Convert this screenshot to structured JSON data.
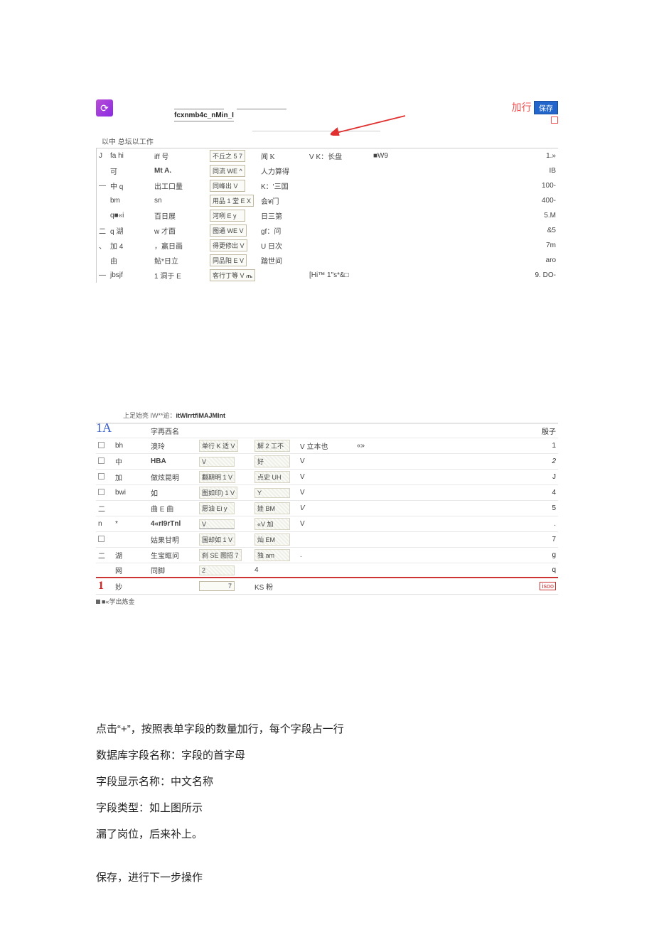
{
  "top": {
    "fcx_label": "fcxnmb4c_nMin_I",
    "add_row_text": "加行",
    "save_btn": "保存",
    "meta_line": "以中 总坛以工作"
  },
  "table1": {
    "rows": [
      {
        "ck": "J",
        "a": "fa hi",
        "b": "iff 号",
        "c": "不丘之 5 7",
        "d": "闻 K",
        "e": "V K：长盘",
        "f": "■W9",
        "r": "1.»"
      },
      {
        "ck": "",
        "a": "可",
        "b": "Mt A.",
        "c": "同流 WE ^",
        "d": "人力算得",
        "e": "",
        "f": "",
        "r": "IB"
      },
      {
        "ck": "—",
        "a": "中 q",
        "b": "出工口量",
        "c": "同峰出 V",
        "d": "K：'三国",
        "e": "",
        "f": "",
        "r": "100-"
      },
      {
        "ck": "",
        "a": "bm",
        "b": "sn",
        "c": "用品 1 堂 E X",
        "d": "会¥门",
        "e": "",
        "f": "",
        "r": "400-"
      },
      {
        "ck": "",
        "a": "q■«i",
        "b": "百日展",
        "c": "河咧 E y",
        "d": "日三第",
        "e": "",
        "f": "",
        "r": "5.M"
      },
      {
        "ck": "二",
        "a": "q 湖",
        "b": "w 才面",
        "c": "图通 WE V",
        "d": "gf：问",
        "e": "",
        "f": "",
        "r": "&5"
      },
      {
        "ck": "、",
        "a": "加 4",
        "b": "，赢日画",
        "c": "得更修出 V",
        "d": "U 日次",
        "e": "",
        "f": "",
        "r": "7m"
      },
      {
        "ck": "",
        "a": "由",
        "b": "鲇*日立",
        "c": "同品阳 E V",
        "d": "踏世间",
        "e": "",
        "f": "",
        "r": "aro"
      },
      {
        "ck": "—",
        "a": "jbsjf",
        "b": "1 洞于 E",
        "c": "客行丁等 V ጤ",
        "d": "",
        "e": "[Hi™ 1\"s*&□",
        "f": "",
        "r": "9. DO-"
      }
    ]
  },
  "shot2": {
    "caption_prefix": "上足始亮 IW**逾：",
    "caption_bold": "itWIrrtfIMAJMInt",
    "one_a": "1A",
    "header": {
      "col_name": "字再西名",
      "col_r": "殷子"
    },
    "rows": [
      {
        "ck": "□",
        "a": "bh",
        "b": "澳玲",
        "c": "单行 K 适 V",
        "d": "解 2 工不",
        "e": "V 立本也",
        "f": "«»",
        "r": "1"
      },
      {
        "ck": "□",
        "a": "中",
        "b": "HBA",
        "c": "V",
        "d": "好",
        "e": "V",
        "f": "",
        "r": "2"
      },
      {
        "ck": "□",
        "a": "加",
        "b": "做炫昆明",
        "c": "翻期明 1 V",
        "d": "点史 UH",
        "e": "V",
        "f": "",
        "r": "J"
      },
      {
        "ck": "□",
        "a": "bwi",
        "b": "如",
        "c": "图如印) 1 V",
        "d": "Y",
        "e": "V",
        "f": "",
        "r": "4"
      },
      {
        "ck": "二",
        "a": "",
        "b": "曲 E 曲",
        "c": "愿油 Ei y",
        "d": "娃 BM",
        "e": "V",
        "f": "",
        "r": "5"
      },
      {
        "ck": "n",
        "a": "*",
        "b": "4«rI9rTnl",
        "c": "V",
        "d": "«V 加",
        "e": "V",
        "f": "",
        "r": "."
      },
      {
        "ck": "□",
        "a": "",
        "b": "姑果甘明",
        "c": "国却如 1 V",
        "d": "灿 EM",
        "e": "",
        "f": "",
        "r": "7"
      },
      {
        "ck": "二",
        "a": "湖",
        "b": "生宝眶问",
        "c": "刹 SE  图招 7",
        "d": "独 am",
        "e": ".",
        "f": "",
        "r": "g"
      },
      {
        "ck": "",
        "a": "网",
        "b": "同脚",
        "c": "2",
        "d": "4",
        "e": "",
        "f": "",
        "r": "q"
      }
    ],
    "footer": {
      "mark": "1",
      "a": "妙",
      "c": "7",
      "d": "KS 粉",
      "r": "isoo"
    },
    "footnote": "■«学出炼金"
  },
  "instructions": {
    "p1": "点击“+”，按照表单字段的数量加行，每个字段占一行",
    "p2": "数据库字段名称：字段的首字母",
    "p3": "字段显示名称：中文名称",
    "p4": "字段类型：如上图所示",
    "p5": "漏了岗位，后来补上。",
    "p6": "保存，进行下一步操作"
  }
}
